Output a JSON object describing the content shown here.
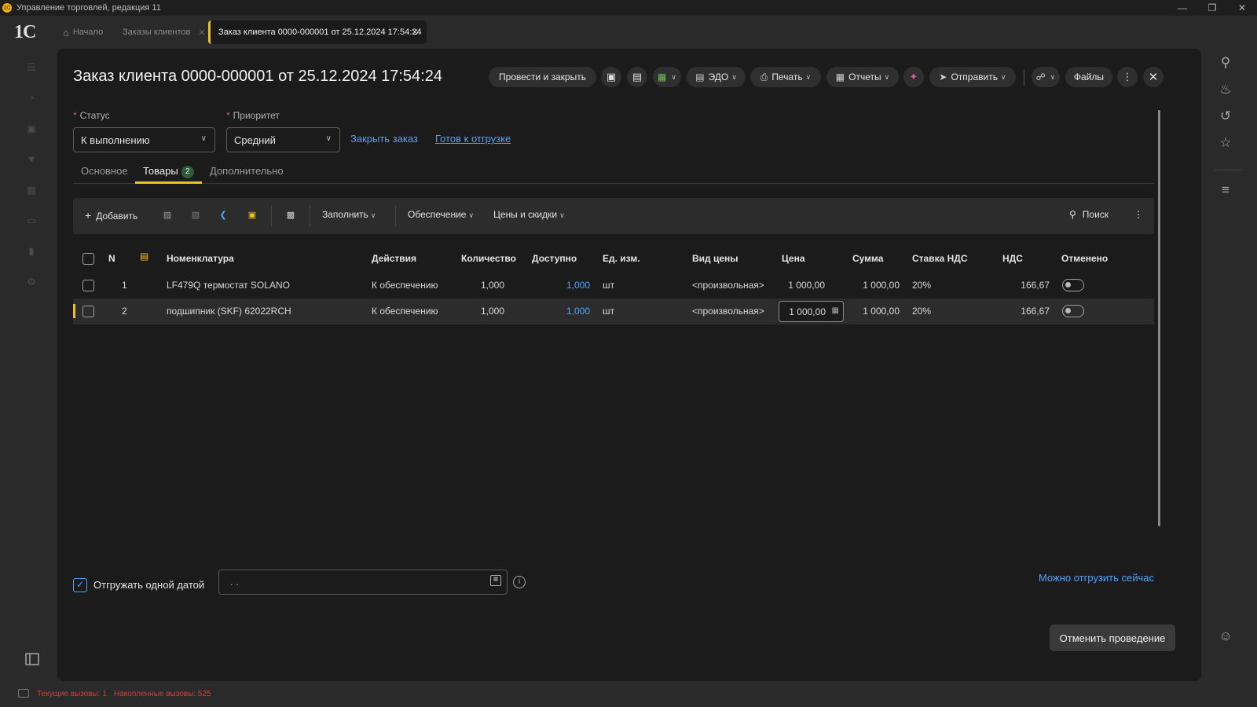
{
  "window": {
    "title": "Управление торговлей, редакция 11",
    "logo": "1C"
  },
  "tabs": {
    "home": "Начало",
    "orders": "Заказы клиентов",
    "active": "Заказ клиента 0000-000001 от 25.12.2024 17:54:24"
  },
  "form": {
    "title": "Заказ клиента 0000-000001 от 25.12.2024 17:54:24",
    "toolbar": {
      "post_close": "Провести и закрыть",
      "edo": "ЭДО",
      "print": "Печать",
      "reports": "Отчеты",
      "send": "Отправить",
      "files": "Файлы"
    },
    "status_label": "Статус",
    "status_value": "К выполнению",
    "priority_label": "Приоритет",
    "priority_value": "Средний",
    "close_order_link": "Закрыть заказ",
    "ready_link": "Готов к отгрузке",
    "subtabs": {
      "main": "Основное",
      "goods": "Товары",
      "goods_count": "2",
      "extra": "Дополнительно"
    }
  },
  "table_toolbar": {
    "add": "Добавить",
    "fill": "Заполнить",
    "supply": "Обеспечение",
    "prices": "Цены и скидки",
    "search": "Поиск"
  },
  "columns": {
    "n": "N",
    "item": "Номенклатура",
    "actions": "Действия",
    "qty": "Количество",
    "available": "Доступно",
    "unit": "Ед. изм.",
    "price_type": "Вид цены",
    "price": "Цена",
    "sum": "Сумма",
    "vat_rate": "Ставка НДС",
    "vat": "НДС",
    "cancelled": "Отменено"
  },
  "rows": [
    {
      "n": "1",
      "item": "LF479Q термостат SOLANO",
      "action": "К обеспечению",
      "qty": "1,000",
      "available": "1,000",
      "unit": "шт",
      "price_type": "<произвольная>",
      "price": "1 000,00",
      "sum": "1 000,00",
      "vat_rate": "20%",
      "vat": "166,67"
    },
    {
      "n": "2",
      "item": "подшипник (SKF) 62022RCH",
      "action": "К обеспечению",
      "qty": "1,000",
      "available": "1,000",
      "unit": "шт",
      "price_type": "<произвольная>",
      "price": "1 000,00",
      "sum": "1 000,00",
      "vat_rate": "20%",
      "vat": "166,67"
    }
  ],
  "footer": {
    "ship_one_date": "Отгружать одной датой",
    "ship_date_value": ". .",
    "ship_now": "Можно отгрузить сейчас",
    "cancel_posting": "Отменить проведение"
  },
  "statusbar": {
    "current_calls": "Текущие вызовы: 1",
    "accumulated_calls": "Накопленные вызовы: 525"
  },
  "colors": {
    "accent": "#f0c020",
    "link": "#4ea3ff",
    "panel": "#1b1b1b",
    "background": "#2a2a2a"
  }
}
